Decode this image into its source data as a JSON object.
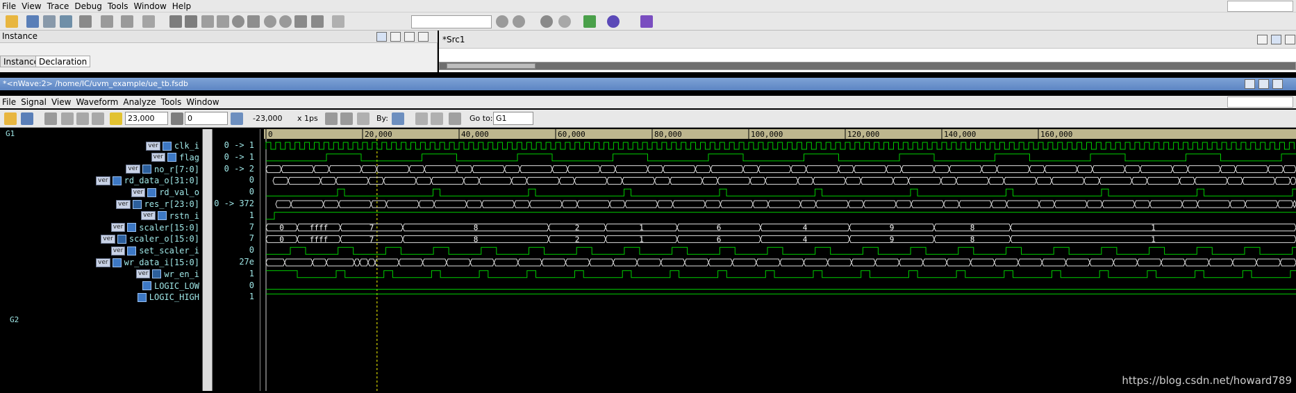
{
  "main_menu": [
    "File",
    "View",
    "Trace",
    "Debug",
    "Tools",
    "Window",
    "Help"
  ],
  "instance_panel": {
    "title": "Instance",
    "tabs": [
      "Instance",
      "Declaration"
    ]
  },
  "source_panel": {
    "title": "*Src1"
  },
  "nwave": {
    "title": "*<nWave:2> /home/IC/uvm_example/ue_tb.fsdb",
    "menu": [
      "File",
      "Signal",
      "View",
      "Waveform",
      "Analyze",
      "Tools",
      "Window"
    ],
    "toolbar": {
      "cursor_time": "23,000",
      "marker_time": "0",
      "delta": "-23,000",
      "unit": "x 1ps",
      "by_label": "By:",
      "goto_label": "Go to:",
      "goto_value": "G1"
    },
    "groups": [
      "G1",
      "G2"
    ],
    "signals": [
      {
        "name": "clk_i",
        "value": "0 -> 1"
      },
      {
        "name": "flag",
        "value": "0 -> 1"
      },
      {
        "name": "no_r[7:0]",
        "value": "0 -> 2"
      },
      {
        "name": "rd_data_o[31:0]",
        "value": "0"
      },
      {
        "name": "rd_val_o",
        "value": "0"
      },
      {
        "name": "res_r[23:0]",
        "value": "0 -> 372"
      },
      {
        "name": "rstn_i",
        "value": "1"
      },
      {
        "name": "scaler[15:0]",
        "value": "7"
      },
      {
        "name": "scaler_o[15:0]",
        "value": "7"
      },
      {
        "name": "set_scaler_i",
        "value": "0"
      },
      {
        "name": "wr_data_i[15:0]",
        "value": "27e"
      },
      {
        "name": "wr_en_i",
        "value": "1"
      },
      {
        "name": "LOGIC_LOW",
        "value": "0"
      },
      {
        "name": "LOGIC_HIGH",
        "value": "1"
      }
    ],
    "ver_tag": "ver",
    "timeline_ticks": [
      "0",
      "20,000",
      "40,000",
      "60,000",
      "80,000",
      "100,000",
      "120,000",
      "140,000",
      "160,000"
    ],
    "bus_labels": {
      "scaler": [
        "0",
        "ffff",
        "7",
        "8",
        "2",
        "1",
        "6",
        "4",
        "9",
        "8",
        "1"
      ],
      "scaler_o": [
        "0",
        "ffff",
        "7",
        "8",
        "2",
        "1",
        "6",
        "4",
        "9",
        "8",
        "1"
      ]
    }
  },
  "watermark": "https://blog.csdn.net/howard789",
  "colors": {
    "wave": "#00d000",
    "bus_text": "#ffffff",
    "signal_text": "#9fe7e7",
    "cursor": "#ffff00",
    "ruler": "#b5b08a"
  }
}
